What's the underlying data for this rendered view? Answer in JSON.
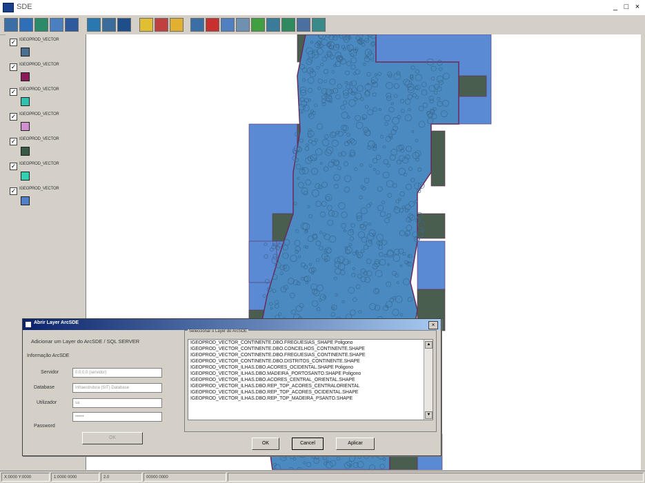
{
  "window": {
    "title": "SDE",
    "min": "_",
    "max": "□",
    "close": "×"
  },
  "toolbar": {
    "buttons": [
      {
        "icon": "open-icon",
        "color": "#3a6ea5"
      },
      {
        "icon": "zoom-in-icon",
        "color": "#2f6fb8"
      },
      {
        "icon": "zoom-out-icon",
        "color": "#2a8a6a"
      },
      {
        "icon": "pan-icon",
        "color": "#4a7fc0"
      },
      {
        "icon": "identify-icon",
        "color": "#2c5a9c"
      },
      {
        "icon": "full-extent-icon",
        "color": "#2a78b0"
      },
      {
        "icon": "table-icon",
        "color": "#3c6c9a"
      },
      {
        "icon": "info-icon",
        "color": "#1f4f8a"
      },
      {
        "icon": "edit-icon",
        "color": "#e0c030"
      },
      {
        "icon": "add-layer-icon",
        "color": "#c04040"
      },
      {
        "icon": "folder-icon",
        "color": "#e0b030"
      },
      {
        "icon": "print-icon",
        "color": "#3a6ea5"
      },
      {
        "icon": "delete-icon",
        "color": "#c83030"
      },
      {
        "icon": "save-icon",
        "color": "#5080c0"
      },
      {
        "icon": "measure-icon",
        "color": "#7090b0"
      },
      {
        "icon": "select-icon",
        "color": "#40a040"
      },
      {
        "icon": "query-icon",
        "color": "#3a7a9a"
      },
      {
        "icon": "legend-icon",
        "color": "#2f8a5f"
      },
      {
        "icon": "export-icon",
        "color": "#4a70a0"
      },
      {
        "icon": "help-icon",
        "color": "#3a8a8a"
      }
    ]
  },
  "layers": {
    "items": [
      {
        "name": "IGEOPROD_VECTOR",
        "checked": "☑",
        "color": "#4a7090"
      },
      {
        "name": "IGEOPROD_VECTOR",
        "checked": "☑",
        "color": "#8a1a5a"
      },
      {
        "name": "IGEOPROD_VECTOR",
        "checked": "☑",
        "color": "#30c0b0"
      },
      {
        "name": "IGEOPROD_VECTOR",
        "checked": "☑",
        "color": "#d090d0"
      },
      {
        "name": "IGEOPROD_VECTOR",
        "checked": "☑",
        "color": "#3a5a48"
      },
      {
        "name": "IGEOPROD_VECTOR",
        "checked": "☑",
        "color": "#30d0b0"
      },
      {
        "name": "IGEOPROD_VECTOR",
        "checked": "☑",
        "color": "#5080c8"
      }
    ]
  },
  "map": {
    "fill_color": "#4a8ac0",
    "polygon_color": "#3a6a94",
    "grid_color": "#4a5e50",
    "border_color": "#6a2a5a"
  },
  "status": {
    "coords": "X:0000 Y:0000",
    "scale": "1:0000 0000",
    "value": "2.0",
    "info": "00000 0000"
  },
  "dialog": {
    "title": "Abrir Layer ArcSDE",
    "heading": "Adicionar um Layer do ArcSDE / SQL SERVER",
    "info_label": "Informação ArcSDE",
    "server_label": "Servidor",
    "server_value": "0.0.0.0 (servidor)",
    "database_label": "Database",
    "database_value": "Infraestrutura (SIT) Database",
    "user_label": "Utilizador",
    "user_value": "sa",
    "password_label": "Password",
    "password_value": "••••••",
    "connect_label": "OK",
    "list_label": "Seleccionar o Layer do ArcSDE",
    "list_items": [
      "IGEOPROD_VECTOR_CONTINENTE.DBO.FREGUESIAS_SHAPE Poligono",
      "IGEOPROD_VECTOR_CONTINENTE.DBO.CONCELHOS_CONTINENTE.SHAPE",
      "IGEOPROD_VECTOR_CONTINENTE.DBO.FREGUESIAS_CONTINENTE.SHAPE",
      "IGEOPROD_VECTOR_CONTINENTE.DBO.DISTRITOS_CONTINENTE.SHAPE",
      "IGEOPROD_VECTOR_ILHAS.DBO.ACORES_OCIDENTAL.SHAPE Poligono",
      "IGEOPROD_VECTOR_ILHAS.DBO.MADEIRA_PORTOSANTO.SHAPE Poligono",
      "IGEOPROD_VECTOR_ILHAS.DBO.ACORES_CENTRAL_ORIENTAL.SHAPE",
      "IGEOPROD_VECTOR_ILHAS.DBO.REP_TOP_ACORES_CENTRALORIENTAL",
      "IGEOPROD_VECTOR_ILHAS.DBO.REP_TOP_ACORES_OCIDENTAL.SHAPE",
      "IGEOPROD_VECTOR_ILHAS.DBO.REP_TOP_MADEIRA_PSANTO.SHAPE"
    ],
    "ok_label": "OK",
    "cancel_label": "Cancel",
    "apply_label": "Aplicar"
  }
}
